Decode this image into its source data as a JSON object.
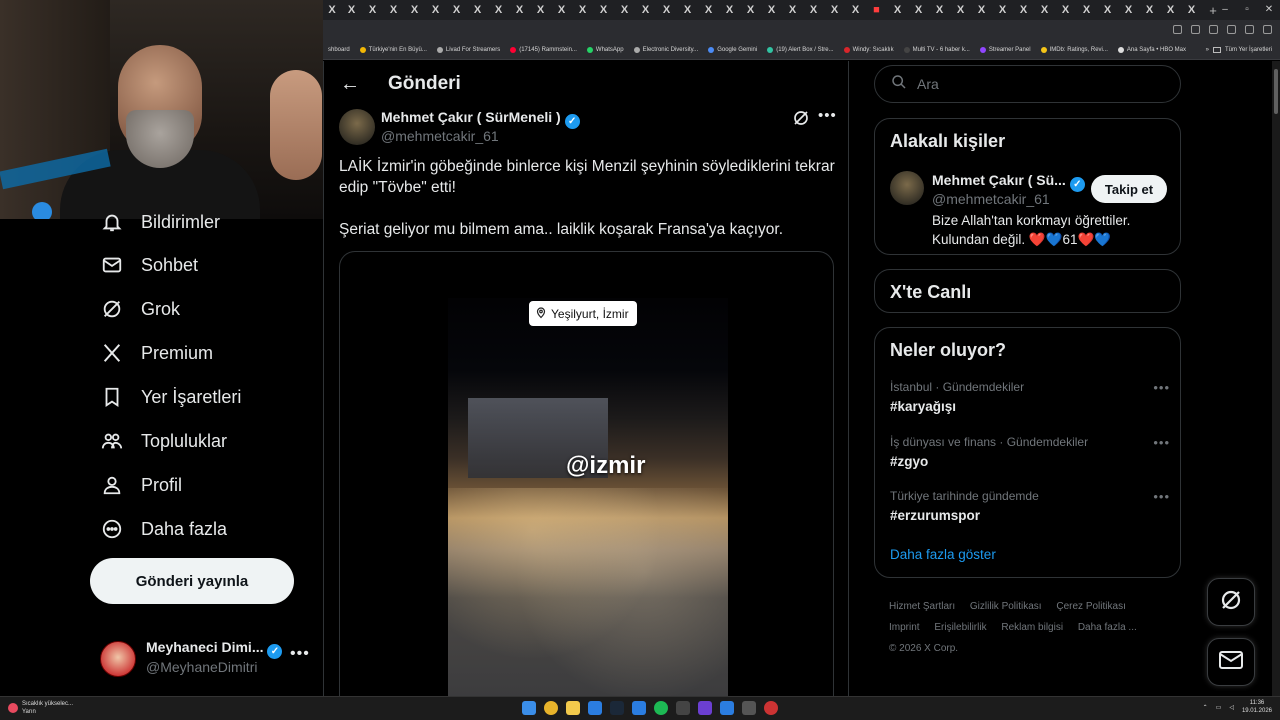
{
  "browser": {
    "tab_close_glyph": "X",
    "new_tab_glyph": "+",
    "bookmarks": [
      {
        "label": "shboard",
        "color": "#888888"
      },
      {
        "label": "Türkiye'nin En Büyü...",
        "color": "#f2b705"
      },
      {
        "label": "Livad For Streamers",
        "color": "#aaaaaa"
      },
      {
        "label": "(17145) Rammstein...",
        "color": "#ff0033"
      },
      {
        "label": "WhatsApp",
        "color": "#25d366"
      },
      {
        "label": "Electronic Diversity...",
        "color": "#aaaaaa"
      },
      {
        "label": "Google Gemini",
        "color": "#4b8bf5"
      },
      {
        "label": "(19) Alert Box / Stre...",
        "color": "#31c3a2"
      },
      {
        "label": "Windy: Sıcaklık",
        "color": "#d9262b"
      },
      {
        "label": "Multi TV - 6 haber k...",
        "color": "#444444"
      },
      {
        "label": "Streamer Panel",
        "color": "#9146ff"
      },
      {
        "label": "IMDb: Ratings, Revi...",
        "color": "#f5c518"
      },
      {
        "label": "Ana Sayfa • HBO Max",
        "color": "#dddddd"
      }
    ],
    "bookmarks_more": "»",
    "all_bookmarks": "Tüm Yer İşaretleri"
  },
  "sidebar": {
    "items": [
      {
        "label": "Bildirimler",
        "icon": "bell-icon"
      },
      {
        "label": "Sohbet",
        "icon": "mail-icon"
      },
      {
        "label": "Grok",
        "icon": "grok-icon"
      },
      {
        "label": "Premium",
        "icon": "x-logo-icon"
      },
      {
        "label": "Yer İşaretleri",
        "icon": "bookmark-icon"
      },
      {
        "label": "Topluluklar",
        "icon": "communities-icon"
      },
      {
        "label": "Profil",
        "icon": "profile-icon"
      },
      {
        "label": "Daha fazla",
        "icon": "more-circle-icon"
      }
    ],
    "post_button": "Gönderi yayınla",
    "account": {
      "name": "Meyhaneci Dimi...",
      "handle": "@MeyhaneDimitri",
      "more": "•••"
    }
  },
  "main": {
    "back": "←",
    "title": "Gönderi",
    "tweet": {
      "author_name": "Mehmet Çakır ( SürMeneli )",
      "author_handle": "@mehmetcakir_61",
      "more": "•••",
      "text_1": "LAİK İzmir'in göbeğinde binlerce kişi Menzil şeyhinin söylediklerini tekrar edip \"Tövbe\" etti!",
      "text_2": "Şeriat geliyor mu bilmem ama.. laiklik koşarak Fransa'ya kaçıyor.",
      "video_location": "Yeşilyurt, İzmir",
      "video_overlay": "@izmir"
    }
  },
  "right": {
    "search_placeholder": "Ara",
    "related": {
      "title": "Alakalı kişiler",
      "name": "Mehmet Çakır ( Sü...",
      "handle": "@mehmetcakir_61",
      "follow": "Takip et",
      "bio": "Bize Allah'tan korkmayı öğrettiler. Kulundan değil. ❤️💙61❤️💙"
    },
    "live": {
      "title": "X'te Canlı"
    },
    "trends": {
      "title": "Neler oluyor?",
      "items": [
        {
          "context": "İstanbul · Gündemdekiler",
          "tag": "#karyağışı"
        },
        {
          "context": "İş dünyası ve finans · Gündemdekiler",
          "tag": "#zgyo"
        },
        {
          "context": "Türkiye tarihinde gündemde",
          "tag": "#erzurumspor"
        }
      ],
      "more_glyph": "•••",
      "show_more": "Daha fazla göster"
    },
    "footer": {
      "terms": "Hizmet Şartları",
      "privacy": "Gizlilik Politikası",
      "cookies": "Çerez Politikası",
      "imprint": "Imprint",
      "accessibility": "Erişilebilirlik",
      "ads": "Reklam bilgisi",
      "more": "Daha fazla ...",
      "copyright": "© 2026 X Corp."
    }
  },
  "taskbar": {
    "weather_line1": "Sıcaklık yükselec...",
    "weather_line2": "Yarın",
    "time": "11:36",
    "date": "19.01.2026"
  },
  "colors": {
    "accent": "#1d9bf0",
    "background": "#000000",
    "border": "#2f3336",
    "muted": "#71767b"
  }
}
